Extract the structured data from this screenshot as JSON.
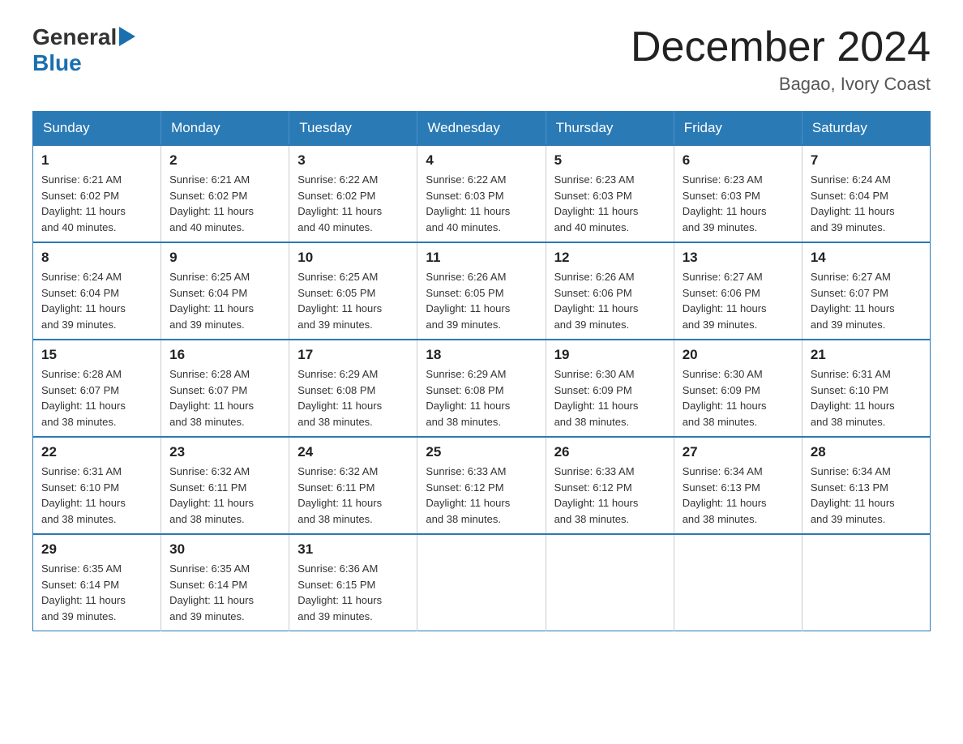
{
  "logo": {
    "general": "General",
    "blue": "Blue"
  },
  "title": "December 2024",
  "location": "Bagao, Ivory Coast",
  "days_of_week": [
    "Sunday",
    "Monday",
    "Tuesday",
    "Wednesday",
    "Thursday",
    "Friday",
    "Saturday"
  ],
  "weeks": [
    [
      {
        "day": "1",
        "sunrise": "6:21 AM",
        "sunset": "6:02 PM",
        "daylight": "11 hours and 40 minutes."
      },
      {
        "day": "2",
        "sunrise": "6:21 AM",
        "sunset": "6:02 PM",
        "daylight": "11 hours and 40 minutes."
      },
      {
        "day": "3",
        "sunrise": "6:22 AM",
        "sunset": "6:02 PM",
        "daylight": "11 hours and 40 minutes."
      },
      {
        "day": "4",
        "sunrise": "6:22 AM",
        "sunset": "6:03 PM",
        "daylight": "11 hours and 40 minutes."
      },
      {
        "day": "5",
        "sunrise": "6:23 AM",
        "sunset": "6:03 PM",
        "daylight": "11 hours and 40 minutes."
      },
      {
        "day": "6",
        "sunrise": "6:23 AM",
        "sunset": "6:03 PM",
        "daylight": "11 hours and 39 minutes."
      },
      {
        "day": "7",
        "sunrise": "6:24 AM",
        "sunset": "6:04 PM",
        "daylight": "11 hours and 39 minutes."
      }
    ],
    [
      {
        "day": "8",
        "sunrise": "6:24 AM",
        "sunset": "6:04 PM",
        "daylight": "11 hours and 39 minutes."
      },
      {
        "day": "9",
        "sunrise": "6:25 AM",
        "sunset": "6:04 PM",
        "daylight": "11 hours and 39 minutes."
      },
      {
        "day": "10",
        "sunrise": "6:25 AM",
        "sunset": "6:05 PM",
        "daylight": "11 hours and 39 minutes."
      },
      {
        "day": "11",
        "sunrise": "6:26 AM",
        "sunset": "6:05 PM",
        "daylight": "11 hours and 39 minutes."
      },
      {
        "day": "12",
        "sunrise": "6:26 AM",
        "sunset": "6:06 PM",
        "daylight": "11 hours and 39 minutes."
      },
      {
        "day": "13",
        "sunrise": "6:27 AM",
        "sunset": "6:06 PM",
        "daylight": "11 hours and 39 minutes."
      },
      {
        "day": "14",
        "sunrise": "6:27 AM",
        "sunset": "6:07 PM",
        "daylight": "11 hours and 39 minutes."
      }
    ],
    [
      {
        "day": "15",
        "sunrise": "6:28 AM",
        "sunset": "6:07 PM",
        "daylight": "11 hours and 38 minutes."
      },
      {
        "day": "16",
        "sunrise": "6:28 AM",
        "sunset": "6:07 PM",
        "daylight": "11 hours and 38 minutes."
      },
      {
        "day": "17",
        "sunrise": "6:29 AM",
        "sunset": "6:08 PM",
        "daylight": "11 hours and 38 minutes."
      },
      {
        "day": "18",
        "sunrise": "6:29 AM",
        "sunset": "6:08 PM",
        "daylight": "11 hours and 38 minutes."
      },
      {
        "day": "19",
        "sunrise": "6:30 AM",
        "sunset": "6:09 PM",
        "daylight": "11 hours and 38 minutes."
      },
      {
        "day": "20",
        "sunrise": "6:30 AM",
        "sunset": "6:09 PM",
        "daylight": "11 hours and 38 minutes."
      },
      {
        "day": "21",
        "sunrise": "6:31 AM",
        "sunset": "6:10 PM",
        "daylight": "11 hours and 38 minutes."
      }
    ],
    [
      {
        "day": "22",
        "sunrise": "6:31 AM",
        "sunset": "6:10 PM",
        "daylight": "11 hours and 38 minutes."
      },
      {
        "day": "23",
        "sunrise": "6:32 AM",
        "sunset": "6:11 PM",
        "daylight": "11 hours and 38 minutes."
      },
      {
        "day": "24",
        "sunrise": "6:32 AM",
        "sunset": "6:11 PM",
        "daylight": "11 hours and 38 minutes."
      },
      {
        "day": "25",
        "sunrise": "6:33 AM",
        "sunset": "6:12 PM",
        "daylight": "11 hours and 38 minutes."
      },
      {
        "day": "26",
        "sunrise": "6:33 AM",
        "sunset": "6:12 PM",
        "daylight": "11 hours and 38 minutes."
      },
      {
        "day": "27",
        "sunrise": "6:34 AM",
        "sunset": "6:13 PM",
        "daylight": "11 hours and 38 minutes."
      },
      {
        "day": "28",
        "sunrise": "6:34 AM",
        "sunset": "6:13 PM",
        "daylight": "11 hours and 39 minutes."
      }
    ],
    [
      {
        "day": "29",
        "sunrise": "6:35 AM",
        "sunset": "6:14 PM",
        "daylight": "11 hours and 39 minutes."
      },
      {
        "day": "30",
        "sunrise": "6:35 AM",
        "sunset": "6:14 PM",
        "daylight": "11 hours and 39 minutes."
      },
      {
        "day": "31",
        "sunrise": "6:36 AM",
        "sunset": "6:15 PM",
        "daylight": "11 hours and 39 minutes."
      },
      null,
      null,
      null,
      null
    ]
  ],
  "labels": {
    "sunrise": "Sunrise:",
    "sunset": "Sunset:",
    "daylight": "Daylight:"
  }
}
